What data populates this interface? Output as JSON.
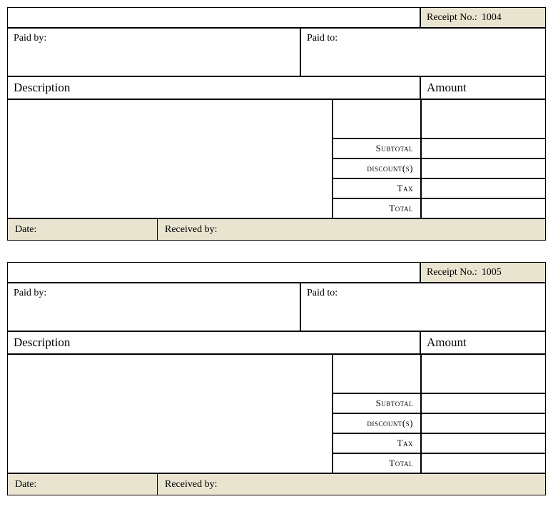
{
  "labels": {
    "receipt_no": "Receipt No.:",
    "paid_by": "Paid by:",
    "paid_to": "Paid to:",
    "description": "Description",
    "amount": "Amount",
    "subtotal": "Subtotal",
    "discounts": "discount(s)",
    "tax": "Tax",
    "total": "Total",
    "date": "Date:",
    "received_by": "Received by:"
  },
  "receipts": [
    {
      "number": "1004",
      "paid_by": "",
      "paid_to": "",
      "description": "",
      "subtotal": "",
      "discounts": "",
      "tax": "",
      "total": "",
      "date": "",
      "received_by": ""
    },
    {
      "number": "1005",
      "paid_by": "",
      "paid_to": "",
      "description": "",
      "subtotal": "",
      "discounts": "",
      "tax": "",
      "total": "",
      "date": "",
      "received_by": ""
    }
  ]
}
